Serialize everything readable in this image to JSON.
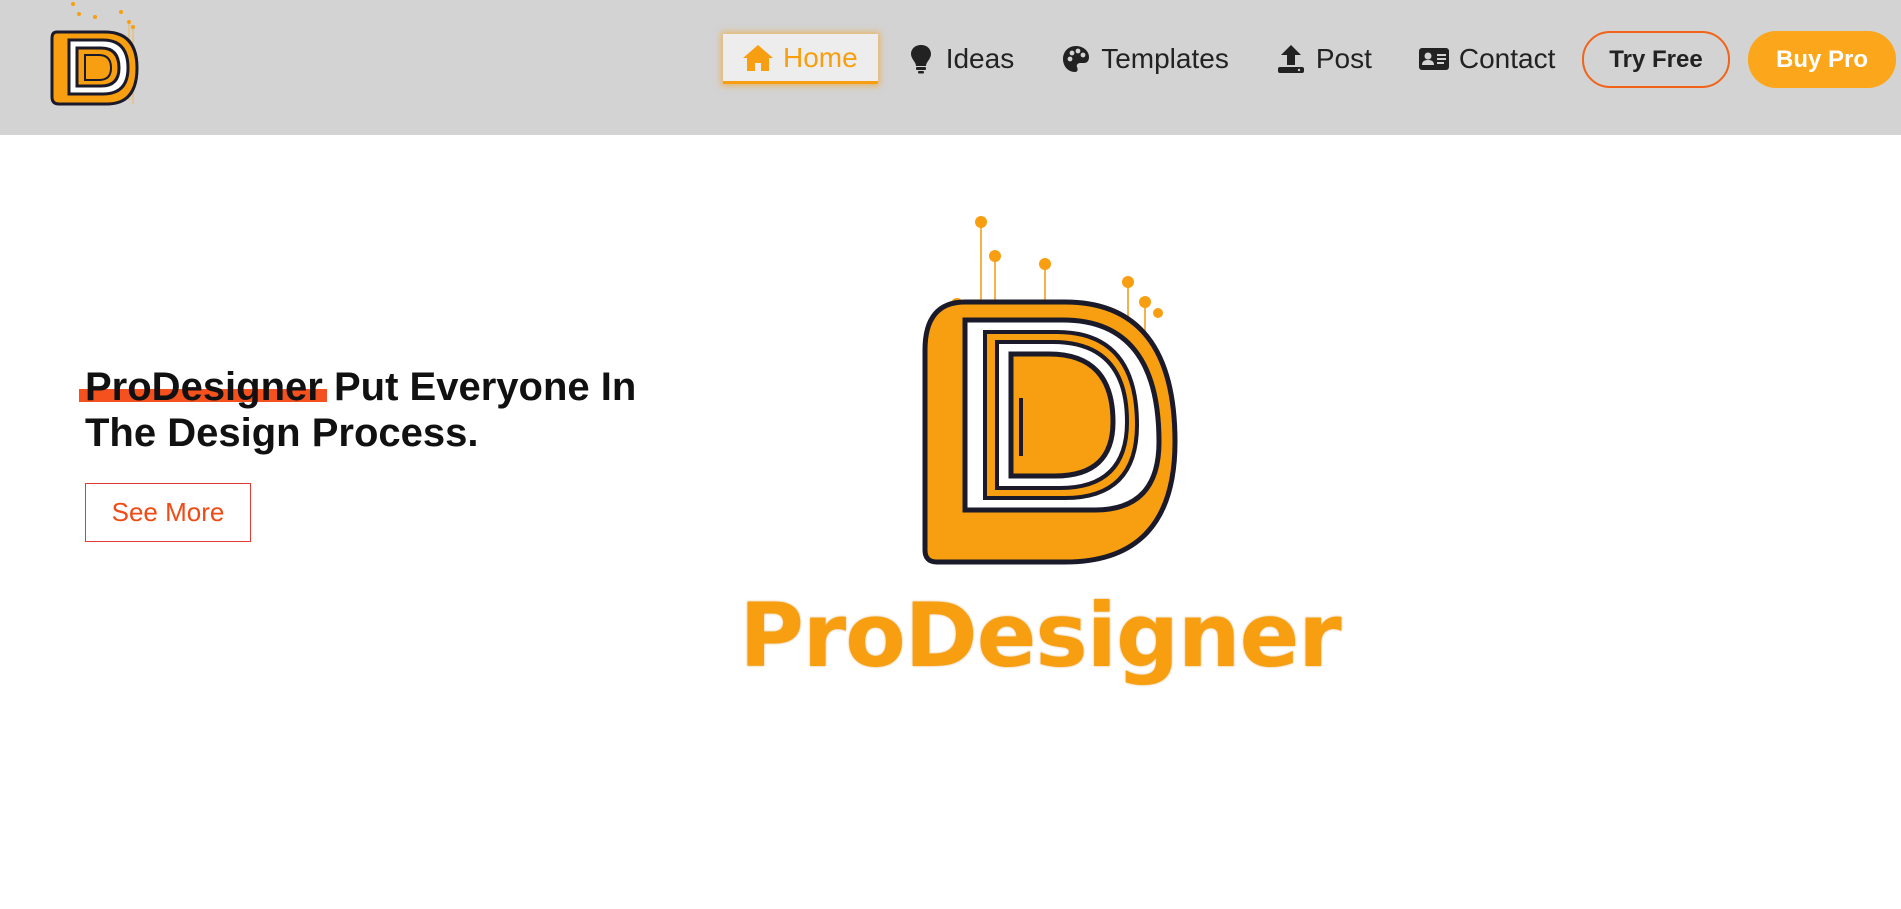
{
  "header": {
    "logo_icon": "prodesigner-d-logo",
    "nav": [
      {
        "label": "Home",
        "icon": "home-icon",
        "active": true
      },
      {
        "label": "Ideas",
        "icon": "lightbulb-icon",
        "active": false
      },
      {
        "label": "Templates",
        "icon": "palette-icon",
        "active": false
      },
      {
        "label": "Post",
        "icon": "upload-icon",
        "active": false
      },
      {
        "label": "Contact",
        "icon": "contact-card-icon",
        "active": false
      }
    ],
    "try_free_label": "Try Free",
    "buy_pro_label": "Buy Pro"
  },
  "hero": {
    "brand": "ProDesigner",
    "headline_rest_line1": " Put Everyone In",
    "headline_line2": "The Design Process.",
    "cta_label": "See More",
    "logo_wordmark": "ProDesigner"
  },
  "colors": {
    "header_bg": "#d3d3d3",
    "accent_orange": "#f79f10",
    "accent_red": "#f4511e",
    "buy_pro_bg": "#fba61b"
  }
}
